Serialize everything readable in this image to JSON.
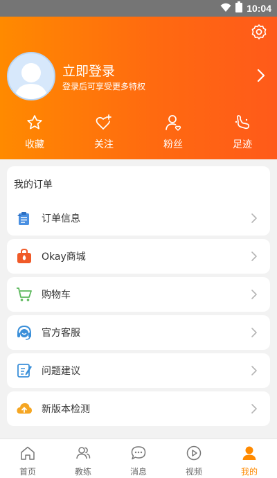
{
  "status_bar": {
    "time": "10:04"
  },
  "header": {
    "login_title": "立即登录",
    "login_subtitle": "登录后可享受更多特权",
    "quick_actions": [
      {
        "label": "收藏",
        "icon": "star-icon"
      },
      {
        "label": "关注",
        "icon": "heart-plus-icon"
      },
      {
        "label": "粉丝",
        "icon": "user-heart-icon"
      },
      {
        "label": "足迹",
        "icon": "footprint-icon"
      }
    ]
  },
  "orders": {
    "title": "我的订单",
    "item": {
      "label": "订单信息",
      "icon": "clipboard-icon"
    }
  },
  "menu": [
    {
      "label": "Okay商城",
      "icon": "shopping-bag-icon"
    },
    {
      "label": "购物车",
      "icon": "cart-icon"
    },
    {
      "label": "官方客服",
      "icon": "headset-icon"
    },
    {
      "label": "问题建议",
      "icon": "edit-icon"
    },
    {
      "label": "新版本检测",
      "icon": "cloud-upload-icon"
    }
  ],
  "bottom_nav": [
    {
      "label": "首页",
      "icon": "home-icon"
    },
    {
      "label": "教练",
      "icon": "users-icon"
    },
    {
      "label": "消息",
      "icon": "message-icon"
    },
    {
      "label": "视频",
      "icon": "play-icon"
    },
    {
      "label": "我的",
      "icon": "user-icon",
      "active": true
    }
  ],
  "colors": {
    "accent": "#ff8a00",
    "header_end": "#ff5a1a"
  }
}
